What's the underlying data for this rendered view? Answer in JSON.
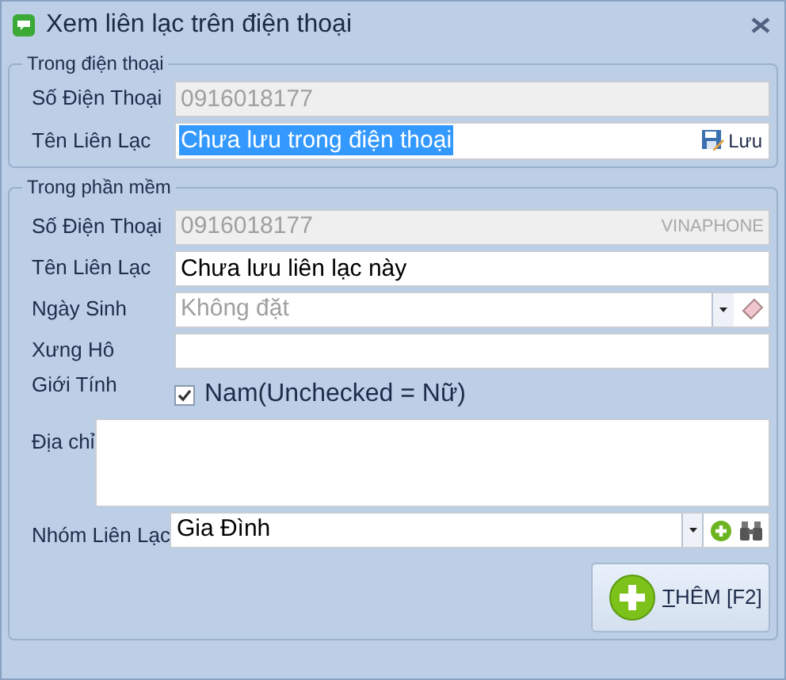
{
  "window": {
    "title": "Xem liên lạc trên điện thoại"
  },
  "phone_group": {
    "title": "Trong điện thoại",
    "phone_label": "Số Điện Thoại",
    "phone_value": "0916018177",
    "name_label": "Tên Liên Lạc",
    "name_value": "Chưa lưu trong điện thoại",
    "save_label": "Lưu"
  },
  "app_group": {
    "title": "Trong phần mềm",
    "phone_label": "Số Điện Thoại",
    "phone_value": "0916018177",
    "carrier": "VINAPHONE",
    "name_label": "Tên Liên Lạc",
    "name_value": "Chưa lưu liên lạc này",
    "birthday_label": "Ngày Sinh",
    "birthday_placeholder": "Không đặt",
    "title_label": "Xưng Hô",
    "gender_label": "Giới Tính",
    "gender_checkbox": {
      "label": "Nam(Unchecked = Nữ)",
      "checked": true
    },
    "address_label": "Địa chỉ",
    "group_label": "Nhóm Liên Lạc",
    "group_value": "Gia Đình"
  },
  "add_button": {
    "label": "THÊM [F2]"
  }
}
